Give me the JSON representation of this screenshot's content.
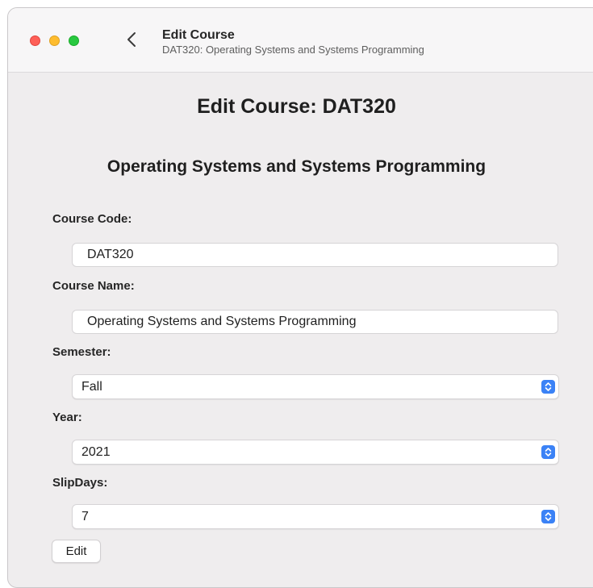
{
  "titlebar": {
    "title": "Edit Course",
    "subtitle": "DAT320: Operating Systems and Systems Programming"
  },
  "icons": {
    "back": "chevron-left-icon",
    "select_arrows": "updown-chevron-icon"
  },
  "colors": {
    "close": "#fe5f57",
    "minimize": "#febc2e",
    "maximize": "#28c840",
    "accent": "#3b82f6",
    "window_background": "#efedee"
  },
  "main": {
    "heading": "Edit Course: DAT320",
    "subheading": "Operating Systems and Systems Programming"
  },
  "form": {
    "course_code": {
      "label": "Course Code:",
      "value": "DAT320"
    },
    "course_name": {
      "label": "Course Name:",
      "value": "Operating Systems and Systems Programming"
    },
    "semester": {
      "label": "Semester:",
      "selected": "Fall"
    },
    "year": {
      "label": "Year:",
      "selected": "2021"
    },
    "slip_days": {
      "label": "SlipDays:",
      "selected": "7"
    },
    "submit_label": "Edit"
  }
}
